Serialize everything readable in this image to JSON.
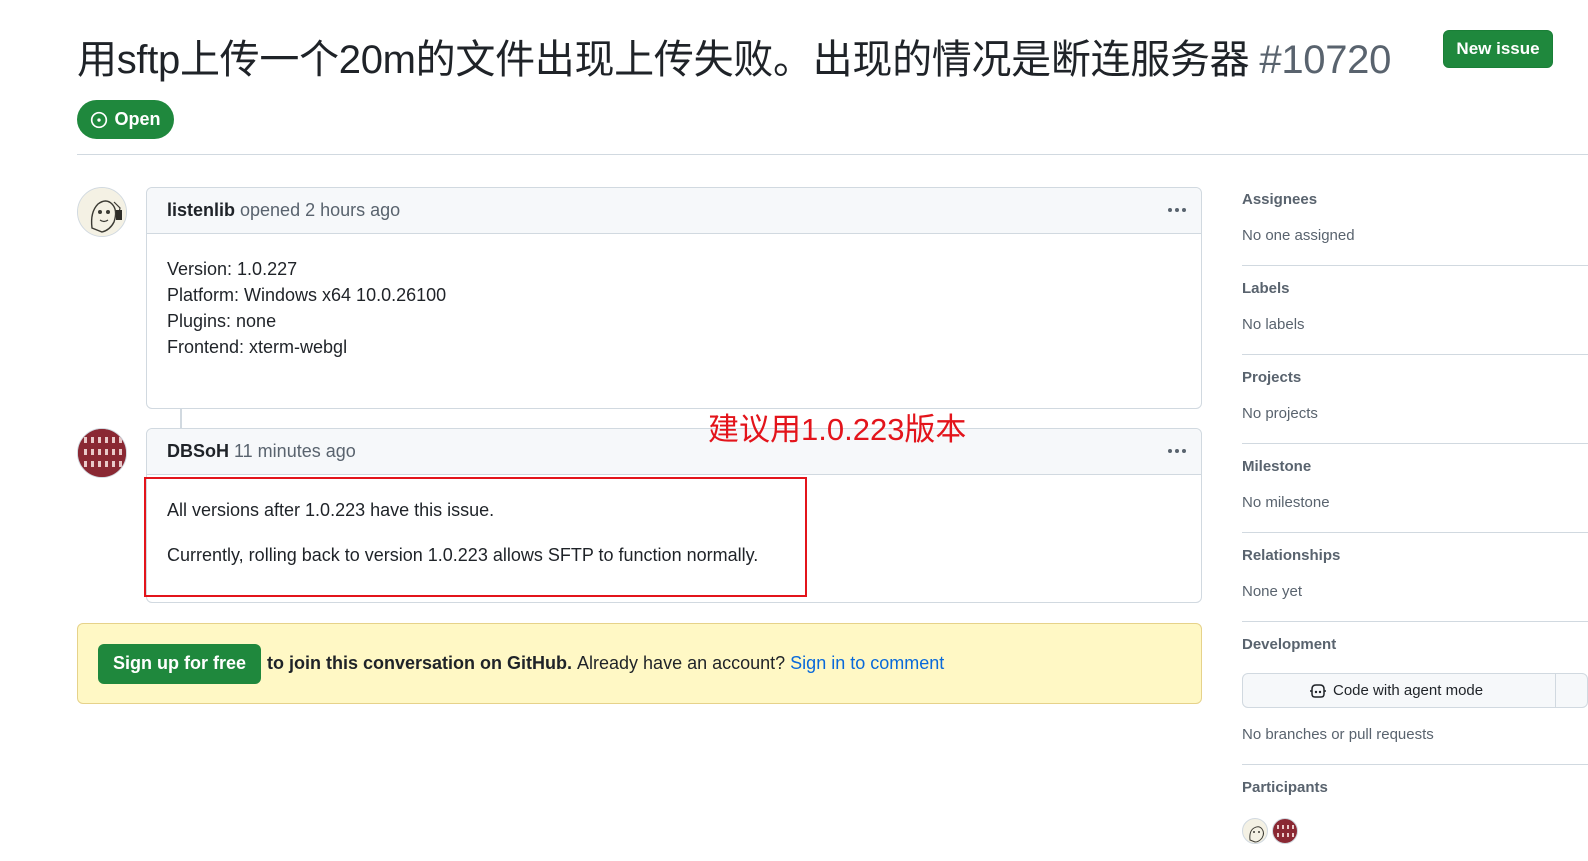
{
  "issue": {
    "title": "用sftp上传一个20m的文件出现上传失败。出现的情况是断连服务器",
    "number": "#10720",
    "state": "Open",
    "new_issue_label": "New issue"
  },
  "comments": [
    {
      "author": "listenlib",
      "meta": "opened 2 hours ago",
      "body": [
        "Version: 1.0.227",
        "Platform: Windows x64 10.0.26100",
        "Plugins: none",
        "Frontend: xterm-webgl"
      ]
    },
    {
      "author": "DBSoH",
      "meta": "11 minutes ago",
      "body": [
        "All versions after 1.0.223 have this issue.",
        "Currently, rolling back to version 1.0.223 allows SFTP to function normally."
      ]
    }
  ],
  "annotation": {
    "text": "建议用1.0.223版本",
    "color": "#e3141b"
  },
  "signup": {
    "button": "Sign up for free",
    "text_strong": "to join this conversation on GitHub.",
    "text": "Already have an account?",
    "link": "Sign in to comment"
  },
  "sidebar": {
    "assignees": {
      "title": "Assignees",
      "value": "No one assigned"
    },
    "labels": {
      "title": "Labels",
      "value": "No labels"
    },
    "projects": {
      "title": "Projects",
      "value": "No projects"
    },
    "milestone": {
      "title": "Milestone",
      "value": "No milestone"
    },
    "relationships": {
      "title": "Relationships",
      "value": "None yet"
    },
    "development": {
      "title": "Development",
      "button": "Code with agent mode",
      "value": "No branches or pull requests"
    },
    "participants": {
      "title": "Participants"
    }
  },
  "colors": {
    "primary_green": "#1f883d",
    "link_blue": "#0969da",
    "muted": "#59636e",
    "banner_bg": "#fff8c5"
  }
}
